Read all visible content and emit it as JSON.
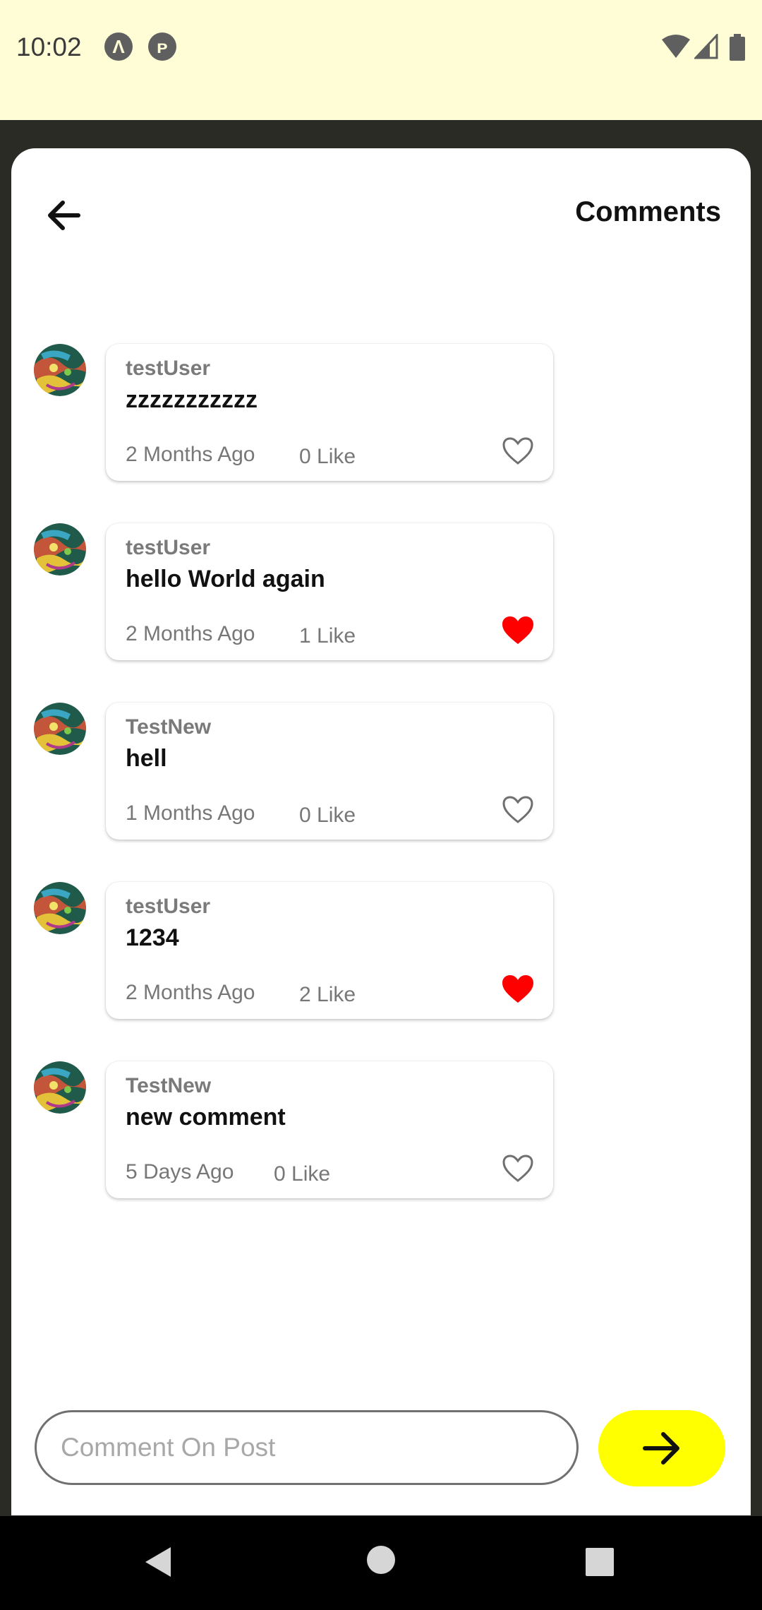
{
  "status_bar": {
    "time": "10:02",
    "left_icons": [
      "a-circle-icon",
      "p-circle-icon"
    ],
    "right_icons": [
      "wifi-icon",
      "signal-icon",
      "battery-icon"
    ]
  },
  "header": {
    "title": "Comments",
    "back_icon": "arrow-left-icon"
  },
  "colors": {
    "accent_yellow": "#ffff00",
    "status_bar_bg": "#fffdd6",
    "liked_heart": "#ff0000",
    "unliked_heart": "#6f6f6f"
  },
  "comments": [
    {
      "user": "testUser",
      "text": "zzzzzzzzzzz",
      "time": "2 Months Ago",
      "likes": "0 Like",
      "liked": false
    },
    {
      "user": "testUser",
      "text": "hello World again",
      "time": "2 Months Ago",
      "likes": "1 Like",
      "liked": true
    },
    {
      "user": "TestNew",
      "text": "hell",
      "time": "1 Months Ago",
      "likes": "0 Like",
      "liked": false
    },
    {
      "user": "testUser",
      "text": "1234",
      "time": "2 Months Ago",
      "likes": "2 Like",
      "liked": true
    },
    {
      "user": "TestNew",
      "text": "new comment",
      "time": "5 Days Ago",
      "likes": "0 Like",
      "liked": false
    }
  ],
  "composer": {
    "placeholder": "Comment On Post",
    "value": "",
    "send_icon": "arrow-right-icon"
  },
  "nav_bar": {
    "icons": [
      "back-triangle-icon",
      "home-circle-icon",
      "recents-square-icon"
    ]
  }
}
